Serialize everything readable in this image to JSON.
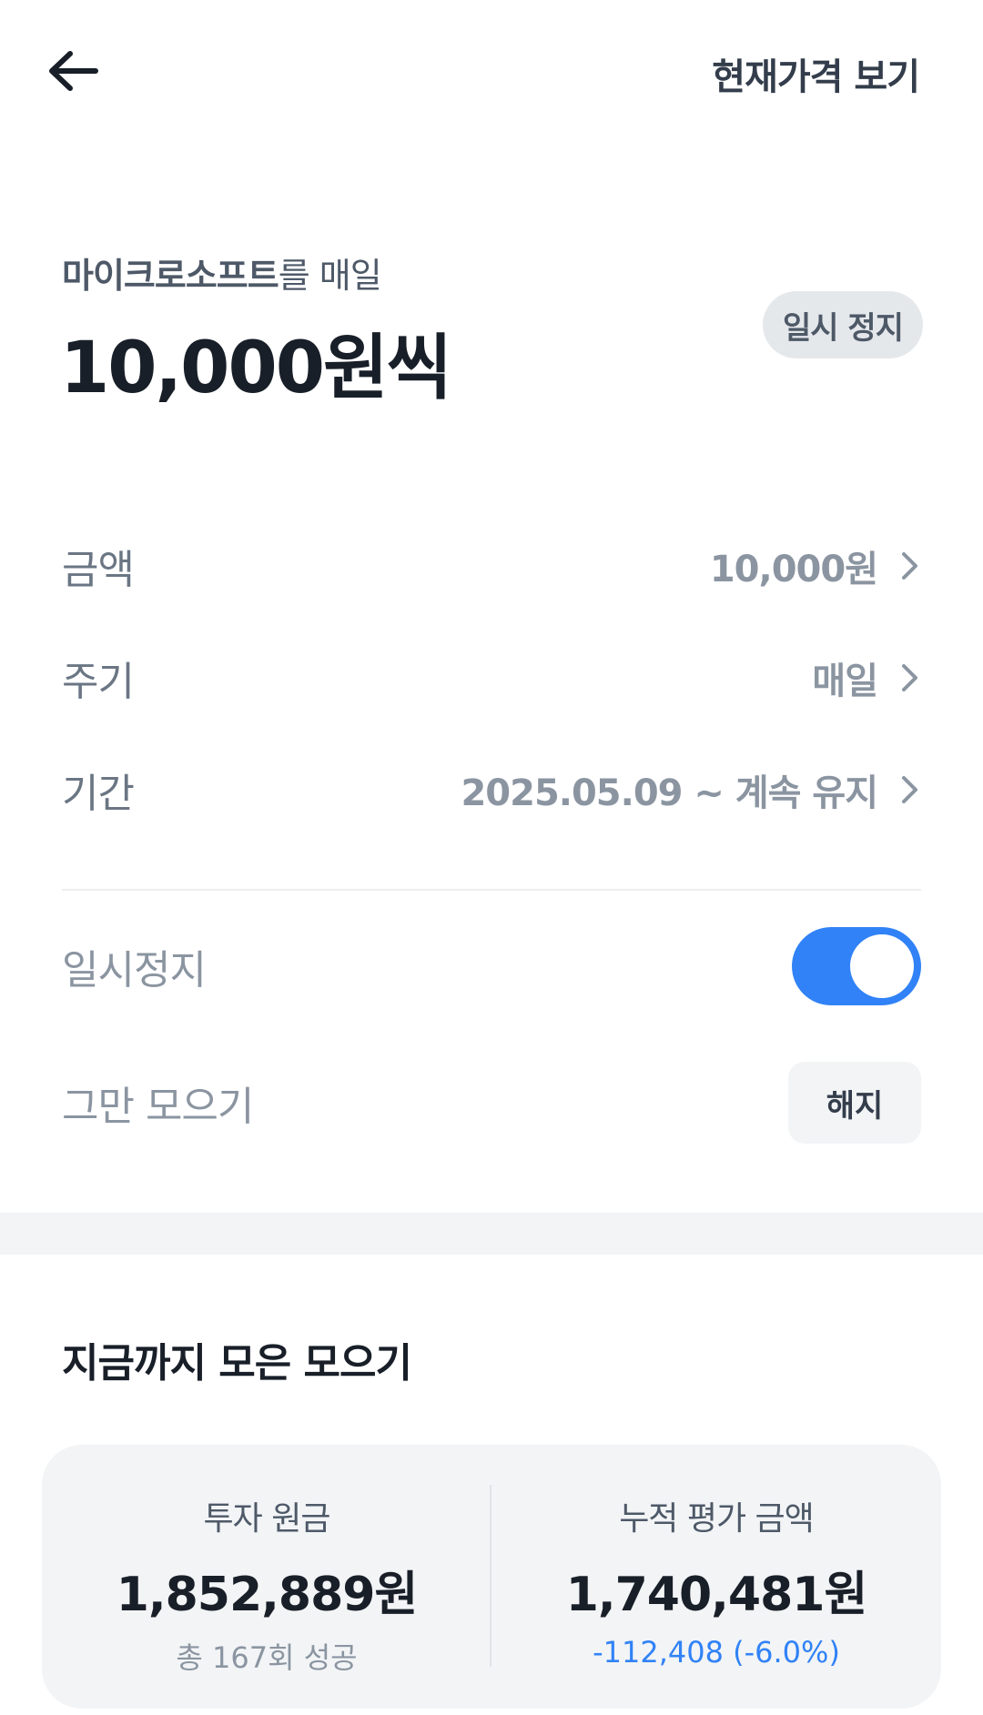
{
  "header": {
    "current_price_link": "현재가격 보기"
  },
  "plan": {
    "stock_name": "마이크로소프트",
    "subtitle_suffix": "를 매일",
    "amount_title": "10,000원씩",
    "pause_badge": "일시 정지"
  },
  "settings": {
    "amount": {
      "label": "금액",
      "value": "10,000원"
    },
    "cycle": {
      "label": "주기",
      "value": "매일"
    },
    "period": {
      "label": "기간",
      "value": "2025.05.09 ~ 계속 유지"
    },
    "pause": {
      "label": "일시정지",
      "enabled": true
    },
    "stop": {
      "label": "그만 모으기",
      "button": "해지"
    }
  },
  "summary": {
    "title": "지금까지 모은 모으기",
    "principal": {
      "label": "투자 원금",
      "value": "1,852,889원",
      "note": "총 167회 성공"
    },
    "valuation": {
      "label": "누적 평가 금액",
      "value": "1,740,481원",
      "change": "-112,408 (-6.0%)"
    }
  },
  "colors": {
    "accent": "#3182f6",
    "text_primary": "#191f28",
    "text_secondary": "#6b7684",
    "surface": "#f2f4f6"
  }
}
